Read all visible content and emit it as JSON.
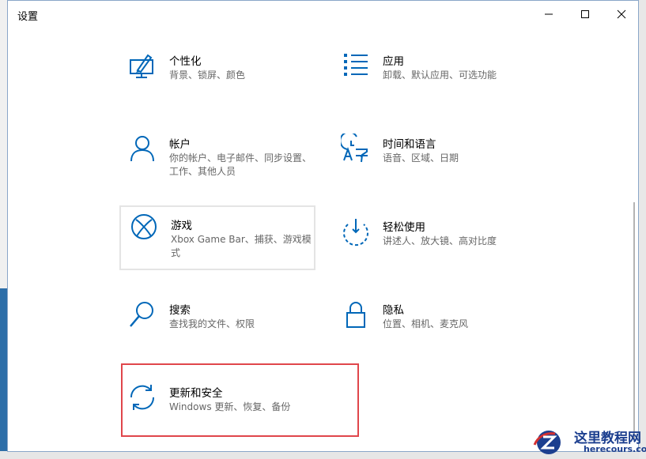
{
  "window": {
    "title": "设置",
    "accent_color": "#0067b8"
  },
  "tiles": [
    {
      "name": "个性化",
      "desc": "背景、锁屏、颜色",
      "icon": "personalization-icon"
    },
    {
      "name": "应用",
      "desc": "卸载、默认应用、可选功能",
      "icon": "apps-icon"
    },
    {
      "name": "帐户",
      "desc": "你的帐户、电子邮件、同步设置、工作、其他人员",
      "icon": "accounts-icon"
    },
    {
      "name": "时间和语言",
      "desc": "语音、区域、日期",
      "icon": "time-language-icon"
    },
    {
      "name": "游戏",
      "desc": "Xbox Game Bar、捕获、游戏模式",
      "icon": "xbox-icon"
    },
    {
      "name": "轻松使用",
      "desc": "讲述人、放大镜、高对比度",
      "icon": "ease-of-access-icon"
    },
    {
      "name": "搜索",
      "desc": "查找我的文件、权限",
      "icon": "search-icon"
    },
    {
      "name": "隐私",
      "desc": "位置、相机、麦克风",
      "icon": "lock-icon"
    },
    {
      "name": "更新和安全",
      "desc": "Windows 更新、恢复、备份",
      "icon": "sync-icon"
    }
  ],
  "watermark": {
    "title": "这里教程网",
    "url": "herecours.com"
  }
}
